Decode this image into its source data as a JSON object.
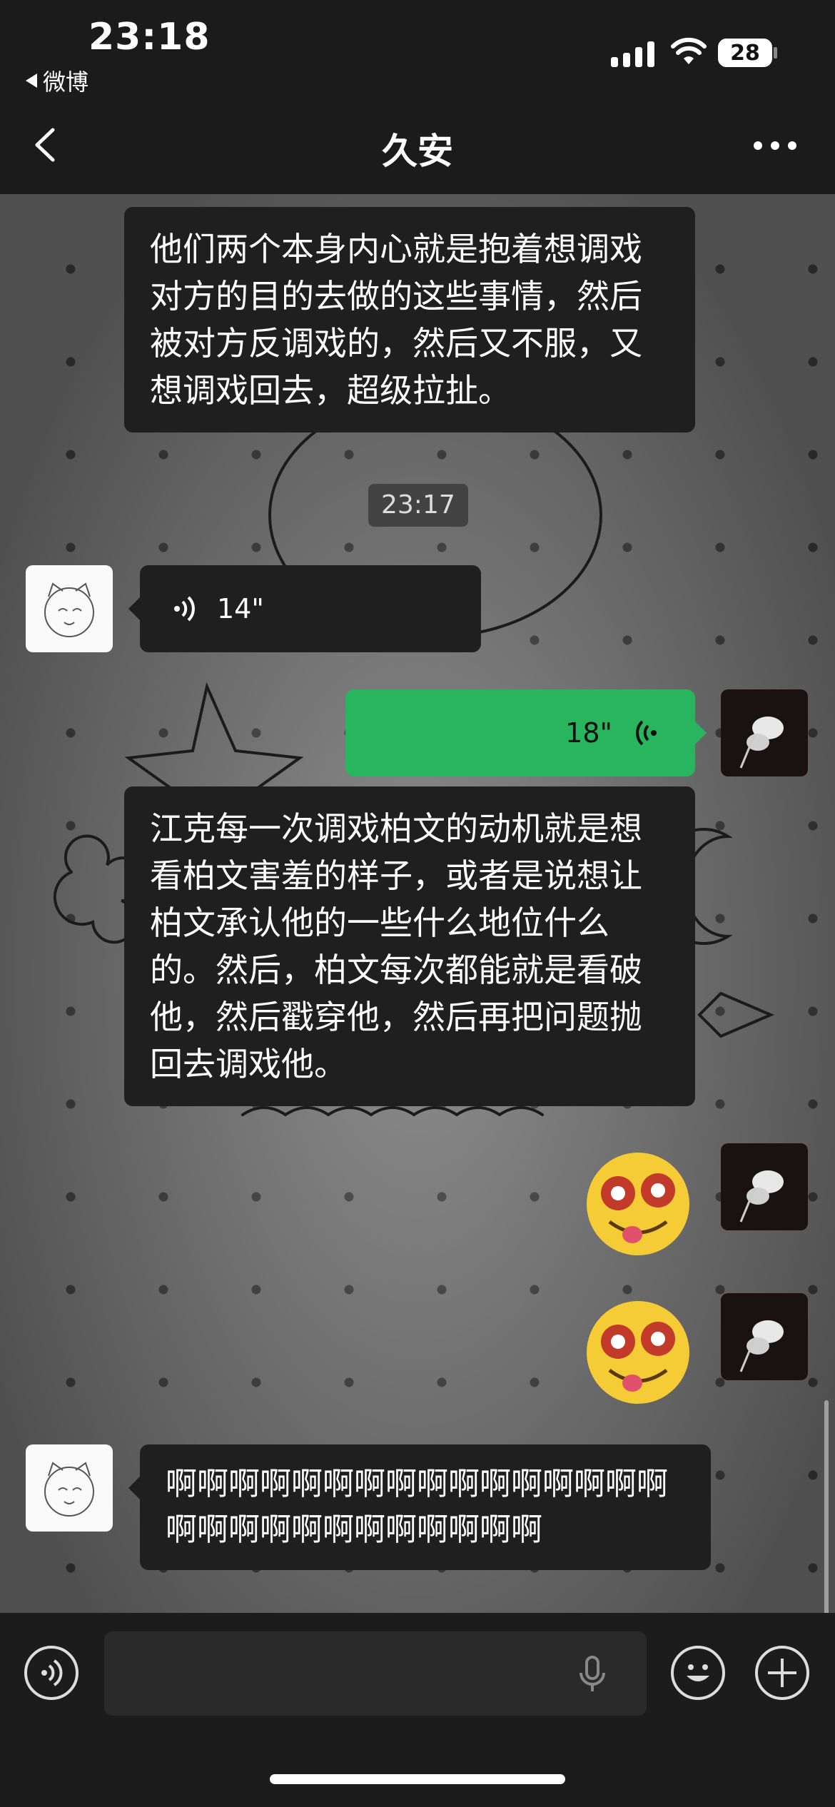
{
  "status_bar": {
    "time": "23:18",
    "back_app": "微博",
    "battery": "28"
  },
  "nav": {
    "title": "久安"
  },
  "messages": {
    "m1": "他们两个本身内心就是抱着想调戏对方的目的去做的这些事情，然后被对方反调戏的，然后又不服，又想调戏回去，超级拉扯。",
    "timestamp": "23:17",
    "voice_left": "14\"",
    "voice_right": "18\"",
    "m2": "江克每一次调戏柏文的动机就是想看柏文害羞的样子，或者是说想让柏文承认他的一些什么地位什么的。然后，柏文每次都能就是看破他，然后戳穿他，然后再把问题抛回去调戏他。",
    "m3": "啊啊啊啊啊啊啊啊啊啊啊啊啊啊啊啊啊啊啊啊啊啊啊啊啊啊啊啊"
  },
  "icons": {
    "voice_toggle": "voice-wave-icon",
    "mic": "microphone-icon",
    "emoji": "smiley-icon",
    "plus": "plus-icon"
  },
  "colors": {
    "accent_green": "#28b55d",
    "bubble_dark": "#1f1f1f"
  }
}
